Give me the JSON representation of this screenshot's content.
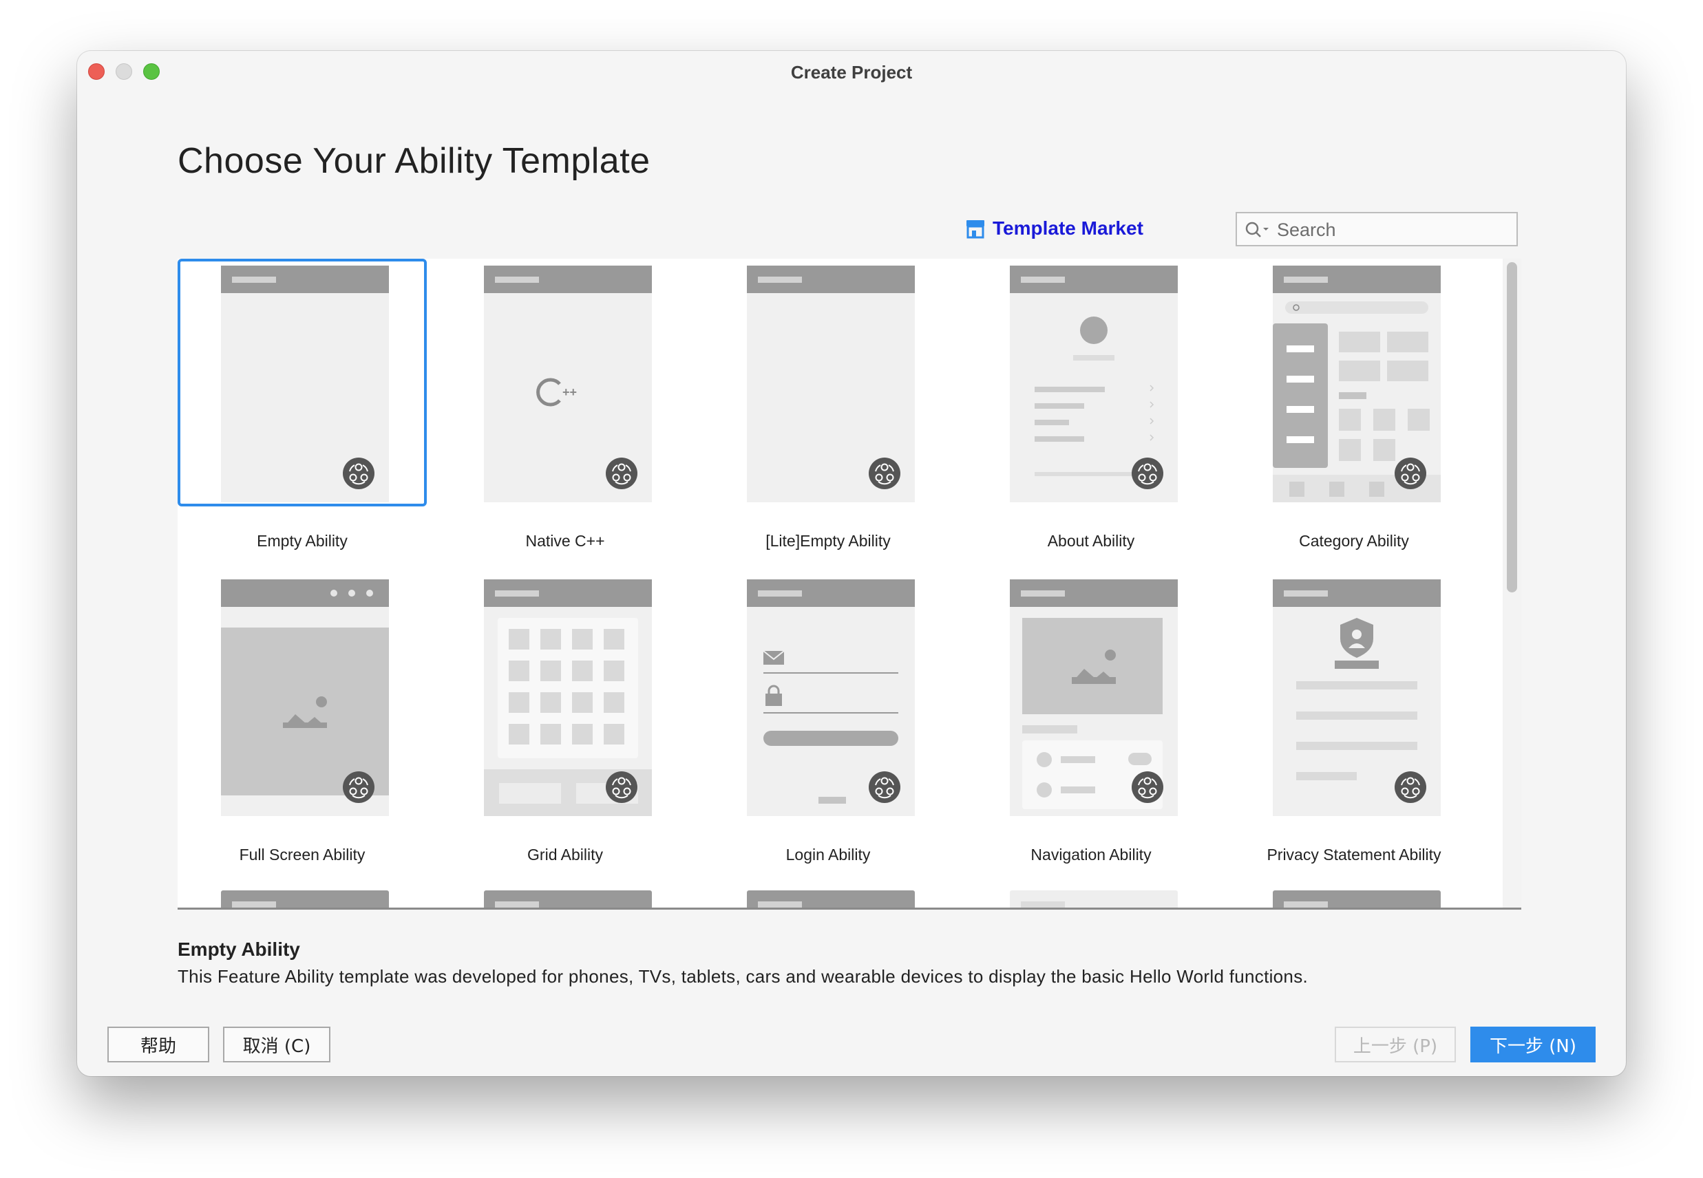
{
  "window": {
    "title": "Create Project"
  },
  "heading": "Choose Your Ability Template",
  "template_market": {
    "label": "Template Market",
    "icon": "store-icon"
  },
  "search": {
    "placeholder": "Search",
    "value": ""
  },
  "templates": [
    {
      "label": "Empty Ability",
      "selected": true
    },
    {
      "label": "Native C++",
      "selected": false
    },
    {
      "label": "[Lite]Empty Ability",
      "selected": false
    },
    {
      "label": "About Ability",
      "selected": false
    },
    {
      "label": "Category Ability",
      "selected": false
    },
    {
      "label": "Full Screen Ability",
      "selected": false
    },
    {
      "label": "Grid Ability",
      "selected": false
    },
    {
      "label": "Login Ability",
      "selected": false
    },
    {
      "label": "Navigation Ability",
      "selected": false
    },
    {
      "label": "Privacy Statement Ability",
      "selected": false
    }
  ],
  "description": {
    "title": "Empty Ability",
    "text": "This Feature Ability template was developed for phones, TVs, tablets, cars and wearable devices to display the basic Hello World functions."
  },
  "buttons": {
    "help": "帮助",
    "cancel": "取消 (C)",
    "previous": "上一步 (P)",
    "next": "下一步 (N)"
  },
  "colors": {
    "accent": "#2e8ceb",
    "market_link": "#1a1ad8",
    "preview_header": "#999999",
    "preview_body": "#f0f0f0",
    "badge": "#555555"
  }
}
